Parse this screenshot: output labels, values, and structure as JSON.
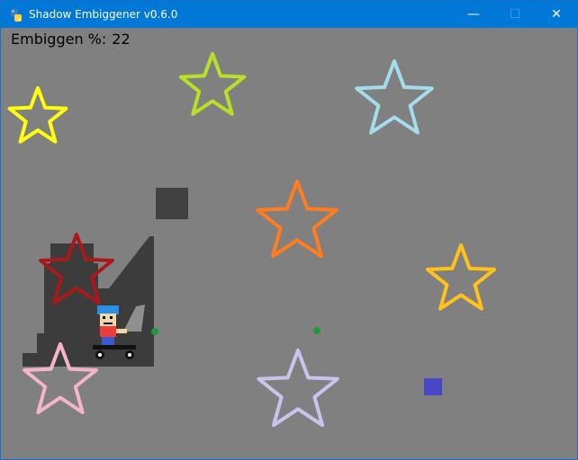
{
  "window": {
    "title": "Shadow Embiggener v0.6.0",
    "minimize_glyph": "—",
    "maximize_glyph": "☐",
    "close_glyph": "✕"
  },
  "hud": {
    "label": "Embiggen %:",
    "value": "22"
  },
  "colors": {
    "titlebar": "#0078d7",
    "background": "#808080",
    "shadow": "#3c3c3c",
    "item_square": "#4747c8",
    "green_dot": "#1f9a3c"
  },
  "stars": [
    {
      "name": "yellow-star",
      "color": "#ffff0e"
    },
    {
      "name": "lime-star",
      "color": "#b9e026"
    },
    {
      "name": "light-blue-star",
      "color": "#a3dcea"
    },
    {
      "name": "orange-star",
      "color": "#ff7d1c"
    },
    {
      "name": "dark-red-star",
      "color": "#a81a1a"
    },
    {
      "name": "gold-star",
      "color": "#ffc21b"
    },
    {
      "name": "pink-star",
      "color": "#f3b5c8"
    },
    {
      "name": "lavender-star",
      "color": "#c9c4ec"
    }
  ]
}
